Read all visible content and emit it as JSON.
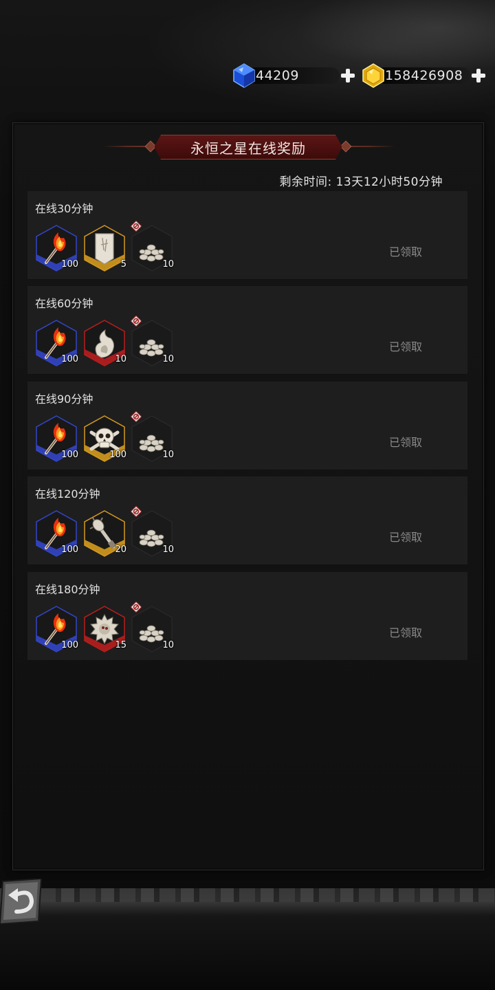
{
  "currency": {
    "gems": {
      "amount": "44209",
      "icon": "blue-gem-icon"
    },
    "gold": {
      "amount": "158426908",
      "icon": "gold-gem-icon"
    }
  },
  "panel": {
    "title": "永恒之星在线奖励",
    "remaining_time": "剩余时间: 13天12小时50分钟"
  },
  "rewards": [
    {
      "label": "在线30分钟",
      "status": "已领取",
      "items": [
        {
          "icon": "torch-icon",
          "quantity": "100",
          "frame": "blue"
        },
        {
          "icon": "banner-icon",
          "quantity": "5",
          "frame": "gold"
        },
        {
          "icon": "stones-icon",
          "quantity": "10",
          "frame": "none"
        }
      ]
    },
    {
      "label": "在线60分钟",
      "status": "已领取",
      "items": [
        {
          "icon": "torch-icon",
          "quantity": "100",
          "frame": "blue"
        },
        {
          "icon": "spirit-flame-icon",
          "quantity": "10",
          "frame": "red"
        },
        {
          "icon": "stones-icon",
          "quantity": "10",
          "frame": "none"
        }
      ]
    },
    {
      "label": "在线90分钟",
      "status": "已领取",
      "items": [
        {
          "icon": "torch-icon",
          "quantity": "100",
          "frame": "blue"
        },
        {
          "icon": "skull-crossbones-icon",
          "quantity": "100",
          "frame": "gold"
        },
        {
          "icon": "stones-icon",
          "quantity": "10",
          "frame": "none"
        }
      ]
    },
    {
      "label": "在线120分钟",
      "status": "已领取",
      "items": [
        {
          "icon": "torch-icon",
          "quantity": "100",
          "frame": "blue"
        },
        {
          "icon": "mace-icon",
          "quantity": "20",
          "frame": "gold"
        },
        {
          "icon": "stones-icon",
          "quantity": "10",
          "frame": "none"
        }
      ]
    },
    {
      "label": "在线180分钟",
      "status": "已领取",
      "items": [
        {
          "icon": "torch-icon",
          "quantity": "100",
          "frame": "blue"
        },
        {
          "icon": "spiked-shell-icon",
          "quantity": "15",
          "frame": "red"
        },
        {
          "icon": "stones-icon",
          "quantity": "10",
          "frame": "none"
        }
      ]
    }
  ],
  "colors": {
    "blue_frame": "#3346c8",
    "gold_frame": "#d49a1e",
    "red_frame": "#b81e1e",
    "title_banner": "#5c1514",
    "status_text": "#8a8a8a"
  },
  "back_button": {
    "icon": "back-arrow-icon"
  }
}
